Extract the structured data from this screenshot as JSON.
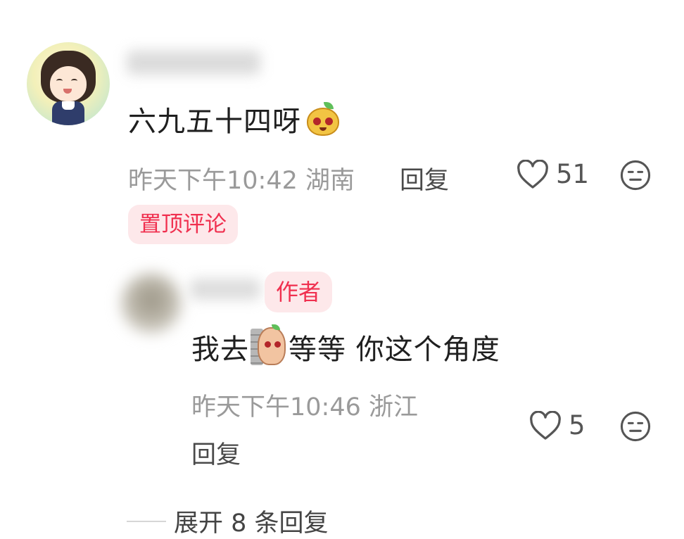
{
  "comment": {
    "username": "",
    "text": "六九五十四呀",
    "emoji": "pear-face-emoji",
    "time": "昨天下午10:42",
    "location": "湖南",
    "reply_label": "回复",
    "likes": "51",
    "pinned_label": "置顶评论"
  },
  "reply": {
    "username": "",
    "author_badge": "作者",
    "text_before": "我去",
    "emoji": "potato-peek-emoji",
    "text_after": "等等 你这个角度",
    "time": "昨天下午10:46",
    "location": "浙江",
    "reply_label": "回复",
    "likes": "5"
  },
  "expand": {
    "label": "展开 8 条回复"
  },
  "icons": {
    "like": "heart-outline-icon",
    "dislike": "meh-face-icon"
  },
  "colors": {
    "accent": "#f0304f",
    "badge_bg": "#fde8ea",
    "meta": "#9a9a9a"
  }
}
